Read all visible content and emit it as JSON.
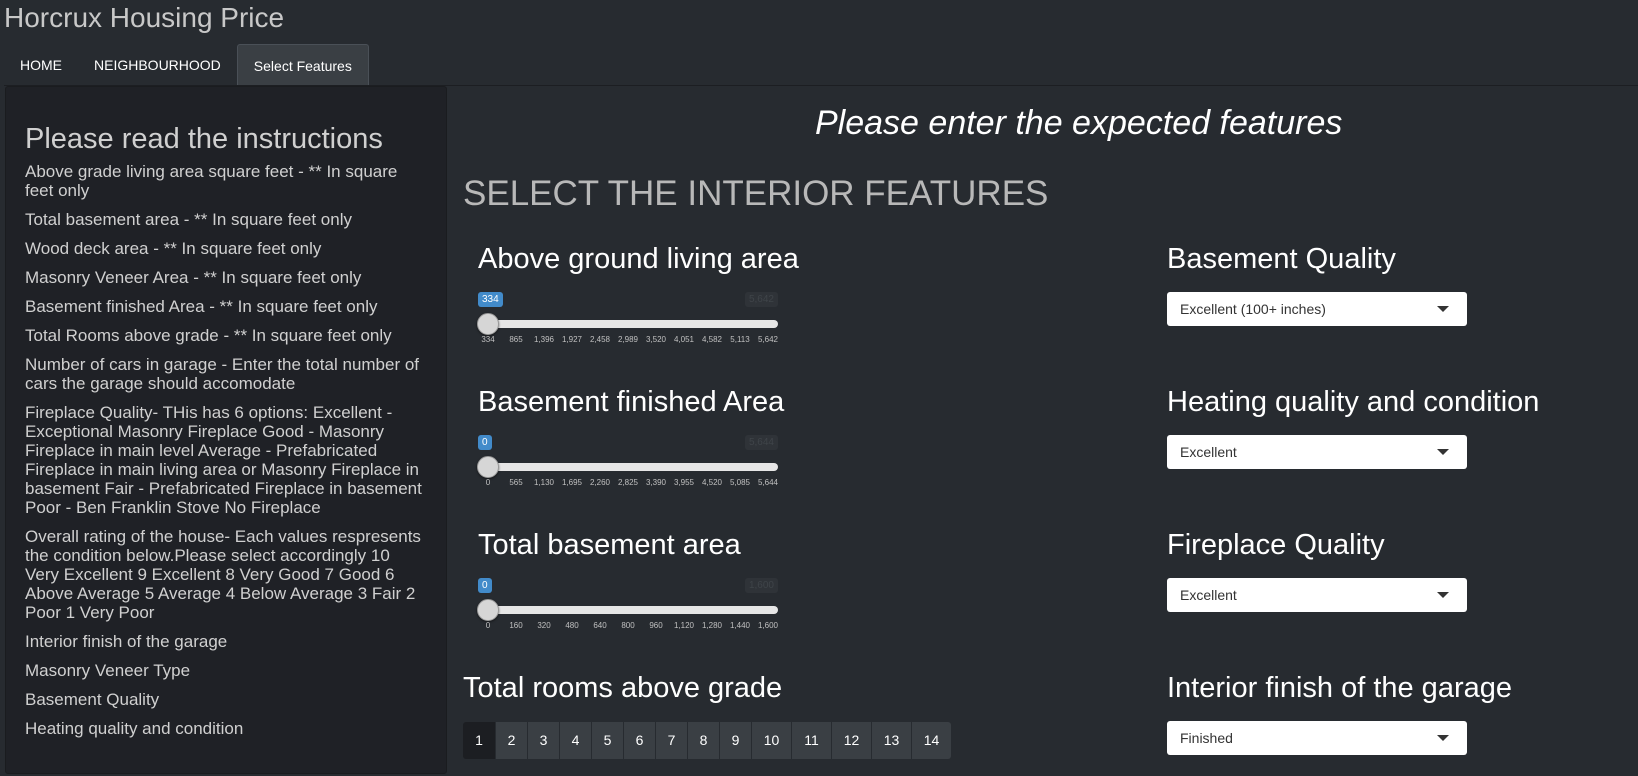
{
  "app": {
    "title": "Horcrux Housing Price"
  },
  "tabs": [
    {
      "label": "HOME",
      "active": false
    },
    {
      "label": "NEIGHBOURHOOD",
      "active": false
    },
    {
      "label": "Select Features",
      "active": true
    }
  ],
  "sidebar": {
    "heading": "Please read the instructions",
    "instructions": [
      "Above grade living area square feet - ** In square feet only",
      "Total basement area - ** In square feet only",
      "Wood deck area - ** In square feet only",
      "Masonry Veneer Area - ** In square feet only",
      "Basement finished Area - ** In square feet only",
      "Total Rooms above grade - ** In square feet only",
      "Number of cars in garage - Enter the total number of cars the garage should accomodate",
      "Fireplace Quality- THis has 6 options: Excellent - Exceptional Masonry Fireplace Good - Masonry Fireplace in main level Average - Prefabricated Fireplace in main living area or Masonry Fireplace in basement Fair - Prefabricated Fireplace in basement Poor - Ben Franklin Stove No Fireplace",
      "Overall rating of the house- Each values respresents the condition below.Please select accordingly 10 Very Excellent 9 Excellent 8 Very Good 7 Good 6 Above Average 5 Average 4 Below Average 3 Fair 2 Poor 1 Very Poor",
      "Interior finish of the garage",
      "Masonry Veneer Type",
      "Basement Quality",
      "Heating quality and condition"
    ]
  },
  "main": {
    "heading": "Please enter the expected features",
    "section_heading": "SELECT THE INTERIOR FEATURES",
    "sliders": [
      {
        "label": "Above ground living area",
        "value": "334",
        "max_label": "5,642",
        "ticks": [
          "334",
          "865",
          "1,396",
          "1,927",
          "2,458",
          "2,989",
          "3,520",
          "4,051",
          "4,582",
          "5,113",
          "5,642"
        ]
      },
      {
        "label": "Basement finished Area",
        "value": "0",
        "max_label": "5,644",
        "ticks": [
          "0",
          "565",
          "1,130",
          "1,695",
          "2,260",
          "2,825",
          "3,390",
          "3,955",
          "4,520",
          "5,085",
          "5,644"
        ]
      },
      {
        "label": "Total basement area",
        "value": "0",
        "max_label": "1,600",
        "ticks": [
          "0",
          "160",
          "320",
          "480",
          "640",
          "800",
          "960",
          "1,120",
          "1,280",
          "1,440",
          "1,600"
        ]
      }
    ],
    "rooms": {
      "label": "Total rooms above grade",
      "options": [
        "1",
        "2",
        "3",
        "4",
        "5",
        "6",
        "7",
        "8",
        "9",
        "10",
        "11",
        "12",
        "13",
        "14"
      ],
      "selected": "1"
    },
    "selects": [
      {
        "label": "Basement Quality",
        "value": "Excellent (100+ inches)"
      },
      {
        "label": "Heating quality and condition",
        "value": "Excellent"
      },
      {
        "label": "Fireplace Quality",
        "value": "Excellent"
      },
      {
        "label": "Interior finish of the garage",
        "value": "Finished"
      }
    ]
  },
  "colors": {
    "background": "#272b30",
    "sidebar": "#1f2126",
    "accent": "#428bca"
  }
}
